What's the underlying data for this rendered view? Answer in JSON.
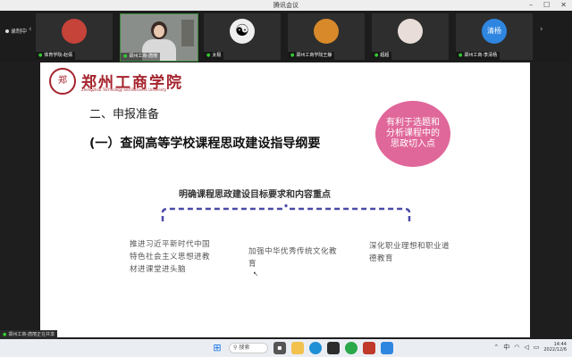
{
  "window": {
    "title": "腾讯会议"
  },
  "recording": {
    "label": "录制中"
  },
  "participants": [
    {
      "name": "体育学院-赵倩"
    },
    {
      "name": "郑州工商-唐丽"
    },
    {
      "name": "太极"
    },
    {
      "name": "郑州工商学院王静"
    },
    {
      "name": "超超"
    },
    {
      "name": "郑州工商-李清杨",
      "avatar_text": "清杨"
    }
  ],
  "slide": {
    "logo_text": "郑州工商学院",
    "logo_subtitle": "Zhengzhou Technology and Business University",
    "heading": "二、申报准备",
    "subheading": "(一）查阅高等学校课程思政建设指导纲要",
    "bubble": "有利于选题和分析课程中的思政切入点",
    "center_title": "明确课程思政建设目标要求和内容重点",
    "items": [
      "推进习近平新时代中国特色社会主义思想进教材进课堂进头脑",
      "加强中华优秀传统文化教育",
      "深化职业理想和职业道德教育"
    ]
  },
  "sharing": {
    "label": "郑州工商-唐丽正在共享"
  },
  "taskbar": {
    "search_label": "搜索",
    "ime": "中",
    "time": "14:44",
    "date": "2022/12/6"
  },
  "colors": {
    "brand": "#a5232d",
    "bubble": "#e0679a",
    "brace": "#4a4aa8"
  }
}
